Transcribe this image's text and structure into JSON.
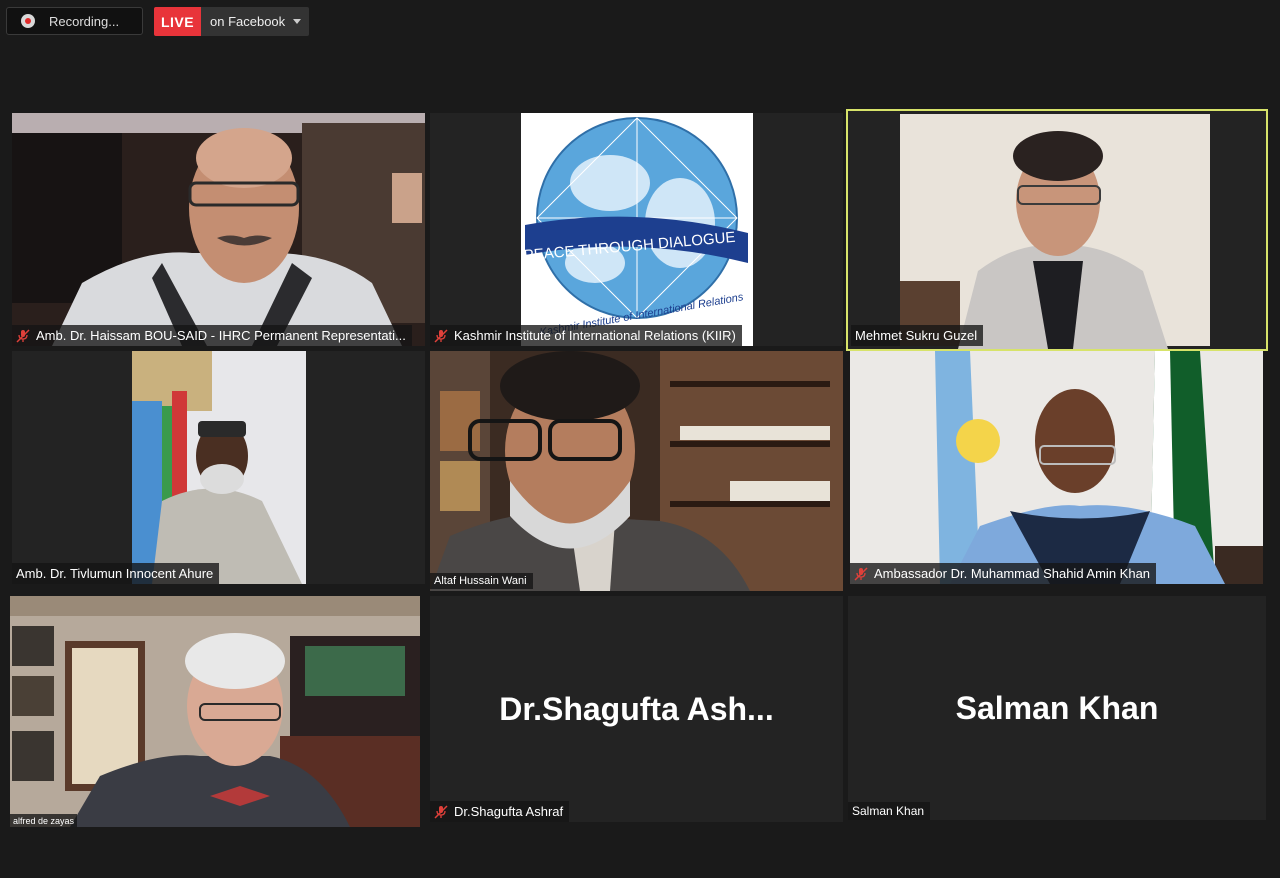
{
  "recording": {
    "label": "Recording..."
  },
  "live": {
    "badge": "LIVE",
    "destination": "on Facebook"
  },
  "tiles": [
    {
      "name": "Amb. Dr. Haissam BOU-SAID - IHRC Permanent Representati...",
      "muted": true
    },
    {
      "name": "Kashmir Institute of International Relations (KIIR)",
      "muted": true,
      "logo": {
        "banner": "PEACE THROUGH DIALOGUE",
        "arc": "Kashmir Institute of International Relations"
      }
    },
    {
      "name": "Mehmet Sukru Guzel",
      "muted": false,
      "active": true
    },
    {
      "name": "Amb. Dr. Tivlumun Innocent Ahure",
      "muted": false
    },
    {
      "name": "Altaf Hussain Wani",
      "muted": false
    },
    {
      "name": "Ambassador Dr. Muhammad Shahid Amin Khan",
      "muted": true
    },
    {
      "name": "alfred de zayas",
      "muted": false
    },
    {
      "name": "Dr.Shagufta Ashraf",
      "display_name": "Dr.Shagufta  Ash...",
      "muted": true
    },
    {
      "name": "Salman Khan",
      "display_name": "Salman Khan",
      "muted": false
    }
  ],
  "colors": {
    "active_speaker": "#d7e36a",
    "live_red": "#e8343a",
    "mute_red": "#e0403a"
  }
}
